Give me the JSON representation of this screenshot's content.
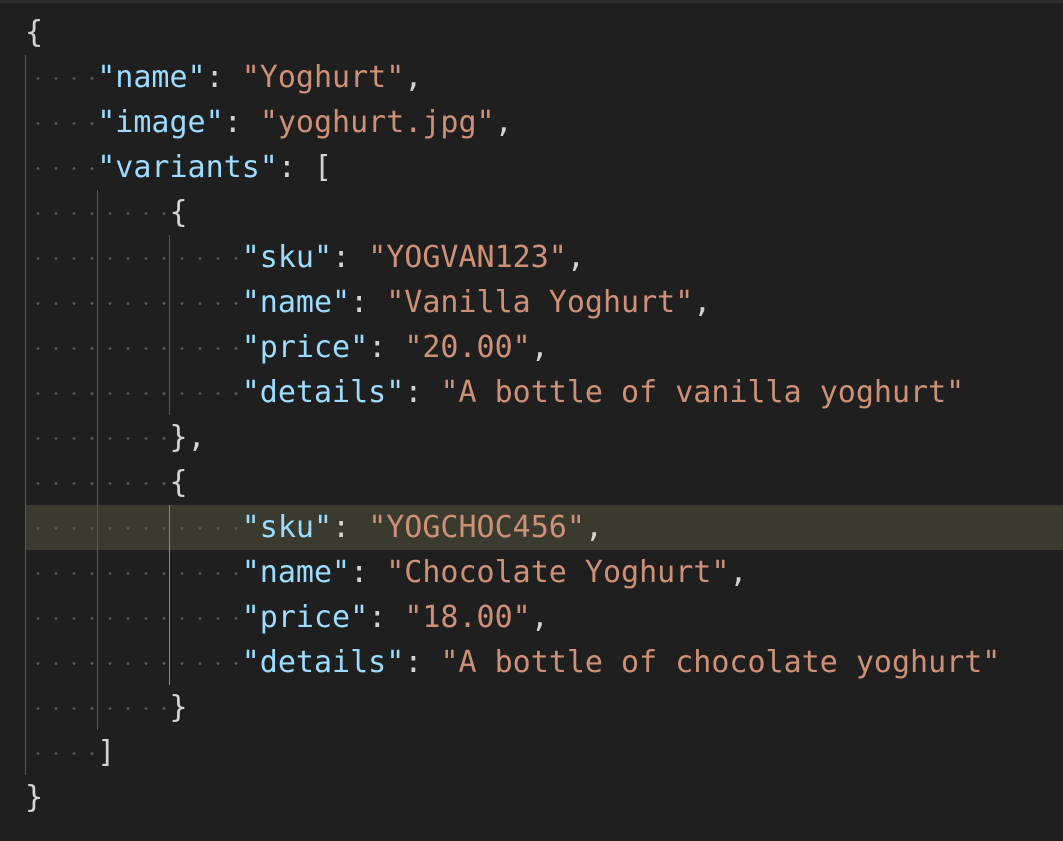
{
  "lines": [
    {
      "indent": 0,
      "open": "{"
    },
    {
      "indent": 1,
      "key": "\"name\"",
      "value": "\"Yoghurt\"",
      "trail": ","
    },
    {
      "indent": 1,
      "key": "\"image\"",
      "value": "\"yoghurt.jpg\"",
      "trail": ","
    },
    {
      "indent": 1,
      "key": "\"variants\"",
      "bracket": "["
    },
    {
      "indent": 2,
      "open": "{"
    },
    {
      "indent": 3,
      "key": "\"sku\"",
      "value": "\"YOGVAN123\"",
      "trail": ","
    },
    {
      "indent": 3,
      "key": "\"name\"",
      "value": "\"Vanilla Yoghurt\"",
      "trail": ","
    },
    {
      "indent": 3,
      "key": "\"price\"",
      "value": "\"20.00\"",
      "trail": ","
    },
    {
      "indent": 3,
      "key": "\"details\"",
      "value": "\"A bottle of vanilla yoghurt\""
    },
    {
      "indent": 2,
      "close": "},"
    },
    {
      "indent": 2,
      "open": "{"
    },
    {
      "indent": 3,
      "key": "\"sku\"",
      "value": "\"YOGCHOC456\"",
      "trail": ",",
      "highlight": true
    },
    {
      "indent": 3,
      "key": "\"name\"",
      "value": "\"Chocolate Yoghurt\"",
      "trail": ","
    },
    {
      "indent": 3,
      "key": "\"price\"",
      "value": "\"18.00\"",
      "trail": ","
    },
    {
      "indent": 3,
      "key": "\"details\"",
      "value": "\"A bottle of chocolate yoghurt\""
    },
    {
      "indent": 2,
      "close": "}"
    },
    {
      "indent": 1,
      "close": "]"
    },
    {
      "indent": 0,
      "close": "}"
    }
  ],
  "colors": {
    "background": "#1f1f1f",
    "key": "#9cdcfe",
    "string": "#ce9178",
    "punctuation": "#d4d4d4",
    "line_highlight": "#3a3a2f",
    "whitespace_dots": "#5a5a5a"
  }
}
